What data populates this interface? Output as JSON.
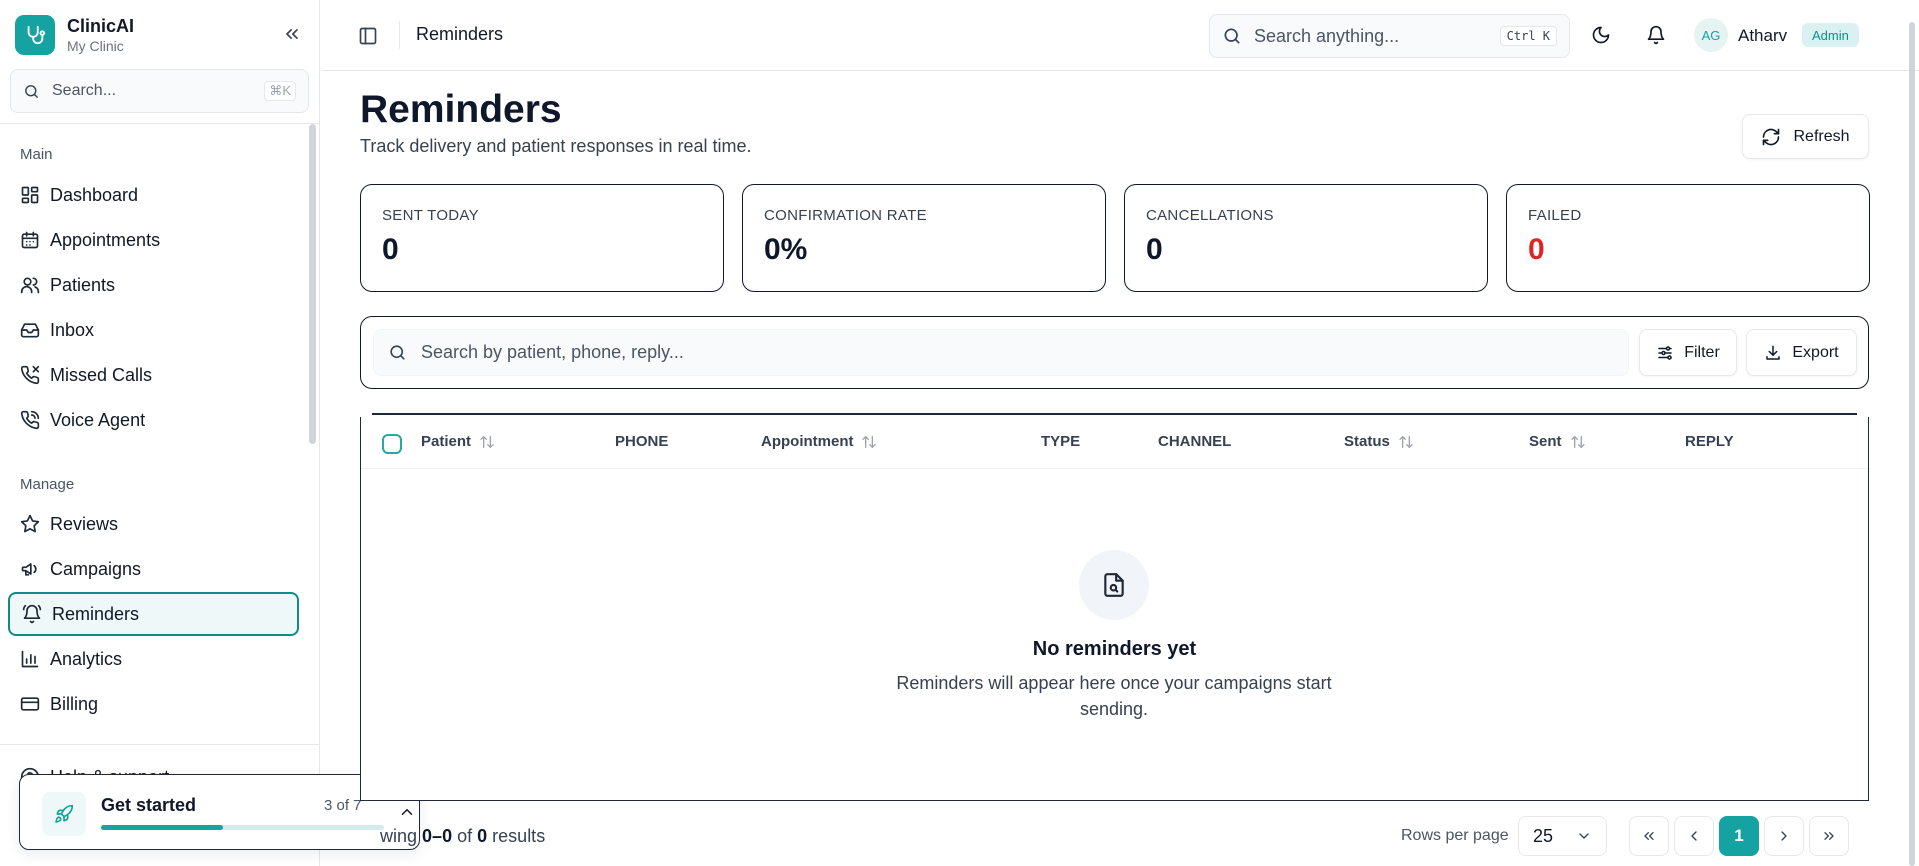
{
  "sidebar": {
    "brand_name": "ClinicAI",
    "brand_sub": "My Clinic",
    "search_placeholder": "Search...",
    "search_shortcut": "⌘K",
    "groups": {
      "main": "Main",
      "manage": "Manage"
    },
    "main_items": [
      {
        "label": "Dashboard",
        "icon": "dashboard-icon"
      },
      {
        "label": "Appointments",
        "icon": "calendar-icon"
      },
      {
        "label": "Patients",
        "icon": "users-icon"
      },
      {
        "label": "Inbox",
        "icon": "inbox-icon"
      },
      {
        "label": "Missed Calls",
        "icon": "phone-missed-icon"
      },
      {
        "label": "Voice Agent",
        "icon": "phone-wave-icon"
      }
    ],
    "manage_items": [
      {
        "label": "Reviews",
        "icon": "star-icon"
      },
      {
        "label": "Campaigns",
        "icon": "megaphone-icon"
      },
      {
        "label": "Reminders",
        "icon": "bell-ring-icon",
        "active": true
      },
      {
        "label": "Analytics",
        "icon": "bar-chart-icon"
      },
      {
        "label": "Billing",
        "icon": "credit-card-icon"
      }
    ],
    "help_label": "Help & support"
  },
  "onboarding": {
    "title": "Get started",
    "progress_text": "3 of 7",
    "progress": 0.43
  },
  "topbar": {
    "title": "Reminders",
    "search_placeholder": "Search anything...",
    "search_shortcut": "Ctrl K",
    "user_initials": "AG",
    "user_name": "Atharv",
    "role": "Admin"
  },
  "page": {
    "title": "Reminders",
    "subtitle": "Track delivery and patient responses in real time.",
    "refresh_label": "Refresh"
  },
  "stats": [
    {
      "label": "SENT TODAY",
      "value": "0"
    },
    {
      "label": "CONFIRMATION RATE",
      "value": "0%"
    },
    {
      "label": "CANCELLATIONS",
      "value": "0"
    },
    {
      "label": "FAILED",
      "value": "0",
      "color": "#dc2626"
    }
  ],
  "table": {
    "search_placeholder": "Search by patient, phone, reply...",
    "filter_label": "Filter",
    "export_label": "Export",
    "columns": [
      "Patient",
      "PHONE",
      "Appointment",
      "TYPE",
      "CHANNEL",
      "Status",
      "Sent",
      "REPLY"
    ],
    "empty_title": "No reminders yet",
    "empty_text": "Reminders will appear here once your campaigns start sending."
  },
  "pagination": {
    "results_prefix": "wing",
    "range": "0–0",
    "of_text": "of",
    "total": "0",
    "results_suffix": "results",
    "rows_label": "Rows per page",
    "rows_per_page": "25",
    "current_page": "1"
  },
  "colors": {
    "accent": "#14a3a0",
    "danger": "#dc2626",
    "border": "#e5e7eb"
  }
}
